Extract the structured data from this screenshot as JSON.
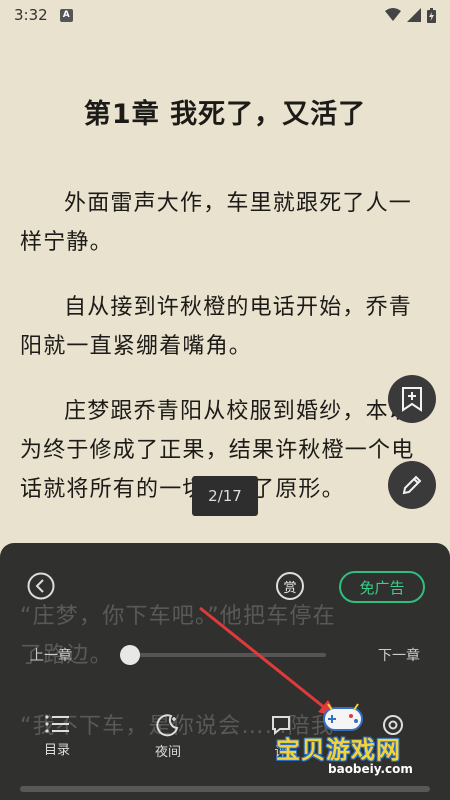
{
  "status": {
    "time": "3:32",
    "notif_badge": "A"
  },
  "chapter": {
    "title": "第1章 我死了，又活了"
  },
  "paragraphs": [
    "外面雷声大作，车里就跟死了人一样宁静。",
    "自从接到许秋橙的电话开始，乔青阳就一直紧绷着嘴角。",
    "庄梦跟乔青阳从校服到婚纱，本以为终于修成了正果，结果许秋橙一个电话就将所有的一切打回了原形。"
  ],
  "hidden_lines": [
    "“庄梦，你下车吧。”他把车停在",
    "了路边。",
    "“我不下车，是你说会……陪我"
  ],
  "page_indicator": "2/17",
  "panel": {
    "reward_label": "赏",
    "no_ads_label": "免广告",
    "prev_chapter": "上一章",
    "next_chapter": "下一章",
    "progress": 0.0,
    "toolbar": [
      {
        "label": "目录",
        "icon": "list-icon"
      },
      {
        "label": "夜间",
        "icon": "moon-icon"
      },
      {
        "label": "评",
        "icon": "comment-icon"
      },
      {
        "label": "",
        "icon": "settings-icon"
      }
    ]
  },
  "watermark": {
    "main": "宝贝游戏网",
    "sub": "baobeiy.com"
  },
  "colors": {
    "page_bg": "#e9e2cf",
    "panel_bg": "#262626",
    "accent": "#2fbf7d",
    "arrow": "#e23a3a"
  }
}
